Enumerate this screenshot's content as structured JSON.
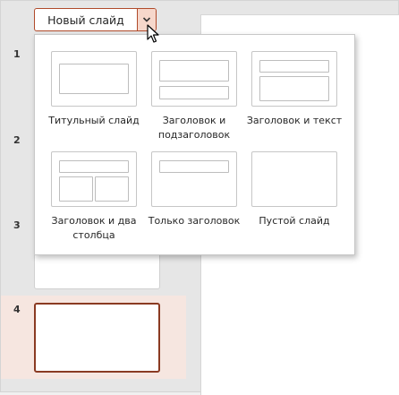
{
  "toolbar": {
    "new_slide_label": "Новый слайд",
    "dropdown_icon": "chevron-down-icon"
  },
  "slides": [
    {
      "number": "1"
    },
    {
      "number": "2"
    },
    {
      "number": "3"
    },
    {
      "number": "4",
      "selected": true
    }
  ],
  "layouts": [
    {
      "label": "Титульный слайд"
    },
    {
      "label": "Заголовок и подзаголовок"
    },
    {
      "label": "Заголовок и текст"
    },
    {
      "label": "Заголовок и два столбца"
    },
    {
      "label": "Только заголовок"
    },
    {
      "label": "Пустой слайд"
    }
  ],
  "colors": {
    "accent": "#b04a2a",
    "accent_light": "#f6d7cb",
    "selected_band": "#f6e6e0"
  }
}
